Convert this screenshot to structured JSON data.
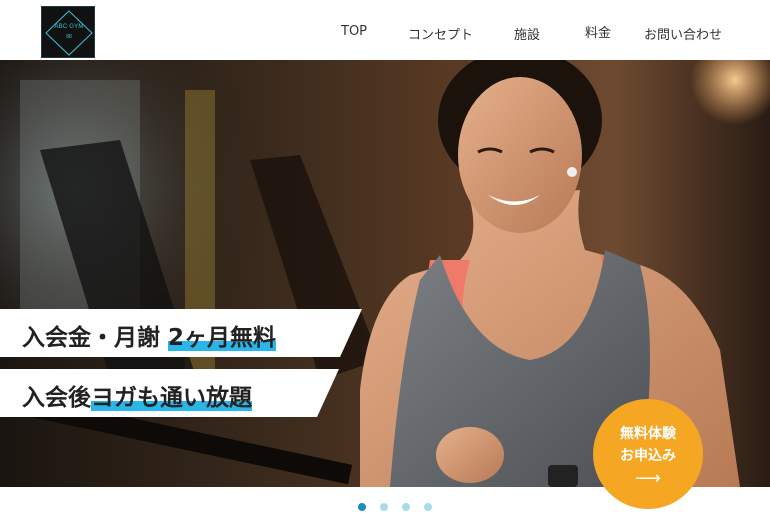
{
  "logo": {
    "text": "ABC GYM",
    "sub": "88"
  },
  "nav": [
    {
      "label": "TOP"
    },
    {
      "label": "コンセプト"
    },
    {
      "label": "施設"
    },
    {
      "label": "料金"
    },
    {
      "label": "お問い合わせ"
    }
  ],
  "hero": {
    "banner1": {
      "prefix": "入会金・月謝 ",
      "highlight": "2ヶ月無料"
    },
    "banner2": {
      "prefix": "入会後",
      "highlight": "ヨガも通い放題"
    }
  },
  "cta": {
    "line1": "無料体験",
    "line2": "お申込み",
    "arrow": "⟶"
  },
  "carousel": {
    "slides": 4,
    "active": 1
  },
  "colors": {
    "accent": "#29b6e8",
    "cta": "#f5a623",
    "dot_active": "#1a8fc0",
    "dot": "#a8dcec"
  }
}
